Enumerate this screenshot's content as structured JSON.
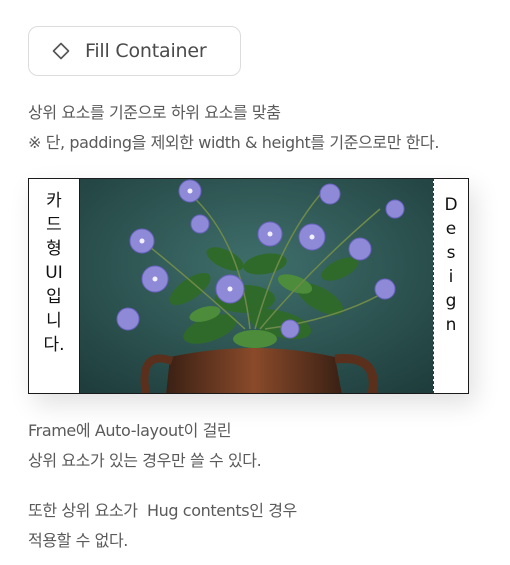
{
  "button": {
    "label": "Fill Container",
    "icon": "diamond-icon"
  },
  "description": {
    "line1": "상위 요소를 기준으로 하위 요소를 맞춤",
    "line2": "※ 단, padding을 제외한 width & height를 기준으로만 한다."
  },
  "frame": {
    "left_chars": [
      "카",
      "드",
      "형",
      "UI",
      "입",
      "니",
      "다."
    ],
    "right_chars": [
      "D",
      "e",
      "s",
      "i",
      "g",
      "n"
    ],
    "image_label": "flower-pot-photo"
  },
  "notes": {
    "block1": [
      "Frame에 Auto-layout이 걸린",
      "상위 요소가 있는 경우만 쓸 수 있다."
    ],
    "block2": [
      "또한 상위 요소가  Hug contents인 경우",
      "적용할 수 없다."
    ]
  }
}
